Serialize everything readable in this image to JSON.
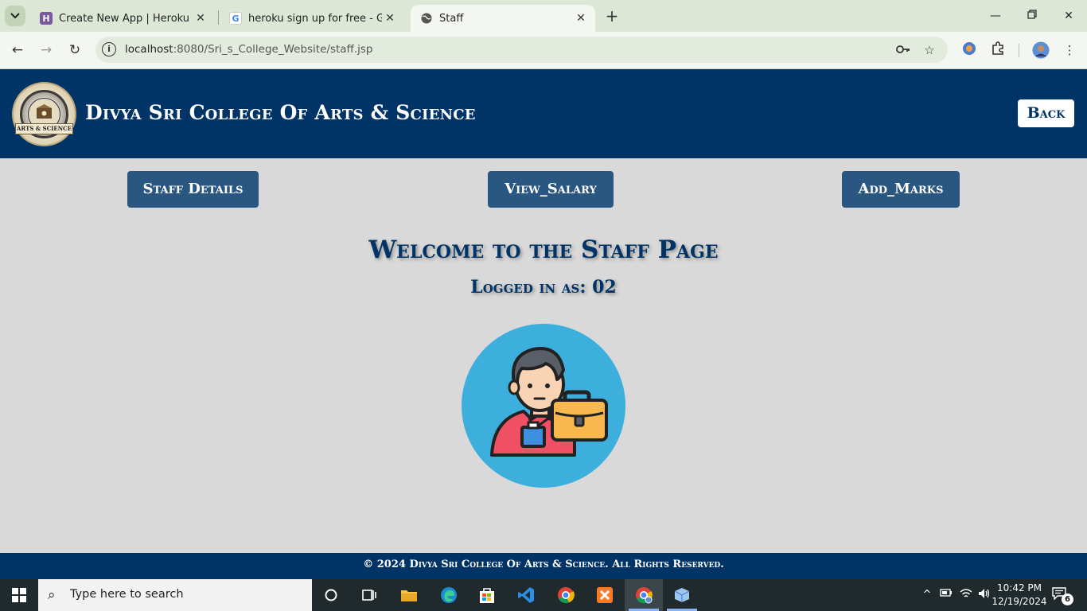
{
  "browser": {
    "tabs": [
      {
        "title": "Create New App | Heroku",
        "favicon": "heroku-icon",
        "active": false
      },
      {
        "title": "heroku sign up for free - Googl",
        "favicon": "google-icon",
        "active": false
      },
      {
        "title": "Staff",
        "favicon": "globe-icon",
        "active": true
      }
    ],
    "url_host": "localhost",
    "url_rest": ":8080/Sri_s_College_Website/staff.jsp"
  },
  "site": {
    "title": "Divya Sri College Of Arts & Science",
    "logo_text": "ARTS & SCIENCE",
    "back_label": "Back",
    "nav": {
      "staff_details": "Staff Details",
      "view_salary": "View_Salary",
      "add_marks": "Add_Marks"
    },
    "welcome": "Welcome to the Staff Page",
    "logged_in": "Logged in as: 02",
    "footer": "© 2024 Divya Sri College Of Arts & Science. All Rights Reserved.",
    "colors": {
      "primary": "#003366",
      "button": "#2a5682",
      "background": "#d9d9d9",
      "avatar_bg": "#3dafdc"
    }
  },
  "taskbar": {
    "search_placeholder": "Type here to search",
    "time": "10:42 PM",
    "date": "12/19/2024",
    "notification_count": "6"
  }
}
